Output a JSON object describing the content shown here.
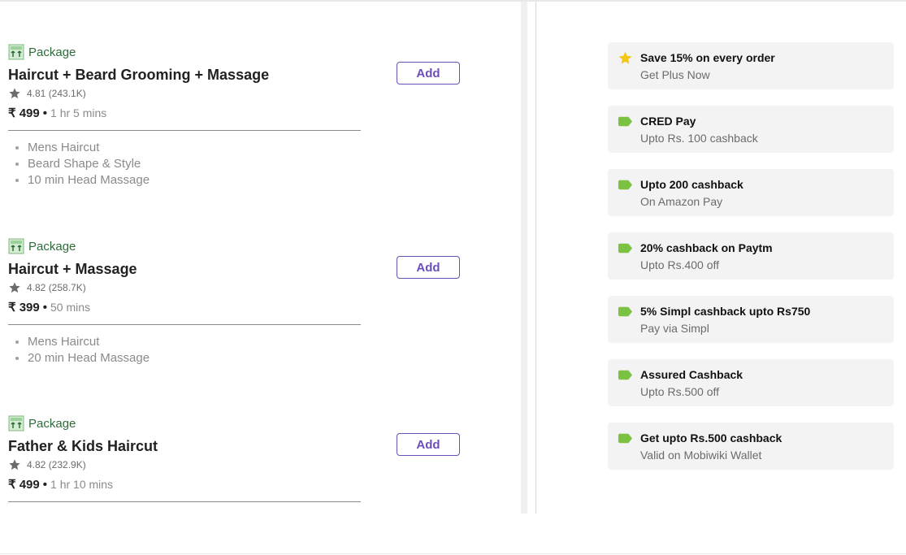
{
  "packages": [
    {
      "tag": "Package",
      "title": "Haircut + Beard Grooming + Massage",
      "rating": "4.81 (243.1K)",
      "price": "₹ 499",
      "duration": "1 hr 5 mins",
      "add_label": "Add",
      "items": [
        "Mens Haircut",
        "Beard Shape & Style",
        "10 min Head Massage"
      ]
    },
    {
      "tag": "Package",
      "title": "Haircut + Massage",
      "rating": "4.82 (258.7K)",
      "price": "₹ 399",
      "duration": "50 mins",
      "add_label": "Add",
      "items": [
        "Mens Haircut",
        "20 min Head Massage"
      ]
    },
    {
      "tag": "Package",
      "title": "Father & Kids Haircut",
      "rating": "4.82 (232.9K)",
      "price": "₹ 499",
      "duration": "1 hr 10 mins",
      "add_label": "Add",
      "items": []
    }
  ],
  "offers": [
    {
      "icon": "star-icon",
      "title": "Save 15% on every order",
      "subtitle": "Get Plus Now"
    },
    {
      "icon": "tag-icon",
      "title": "CRED Pay",
      "subtitle": "Upto Rs. 100 cashback"
    },
    {
      "icon": "tag-icon",
      "title": "Upto 200 cashback",
      "subtitle": "On Amazon Pay"
    },
    {
      "icon": "tag-icon",
      "title": "20% cashback on Paytm",
      "subtitle": "Upto Rs.400 off"
    },
    {
      "icon": "tag-icon",
      "title": "5% Simpl cashback upto Rs750",
      "subtitle": "Pay via Simpl"
    },
    {
      "icon": "tag-icon",
      "title": "Assured Cashback",
      "subtitle": "Upto Rs.500 off"
    },
    {
      "icon": "tag-icon",
      "title": "Get upto Rs.500 cashback",
      "subtitle": "Valid on Mobiwiki Wallet"
    }
  ],
  "colors": {
    "accent": "#6b4fbb",
    "package_tag": "#2e6b3a",
    "offer_tag": "#7cc242",
    "star": "#f5c518"
  }
}
